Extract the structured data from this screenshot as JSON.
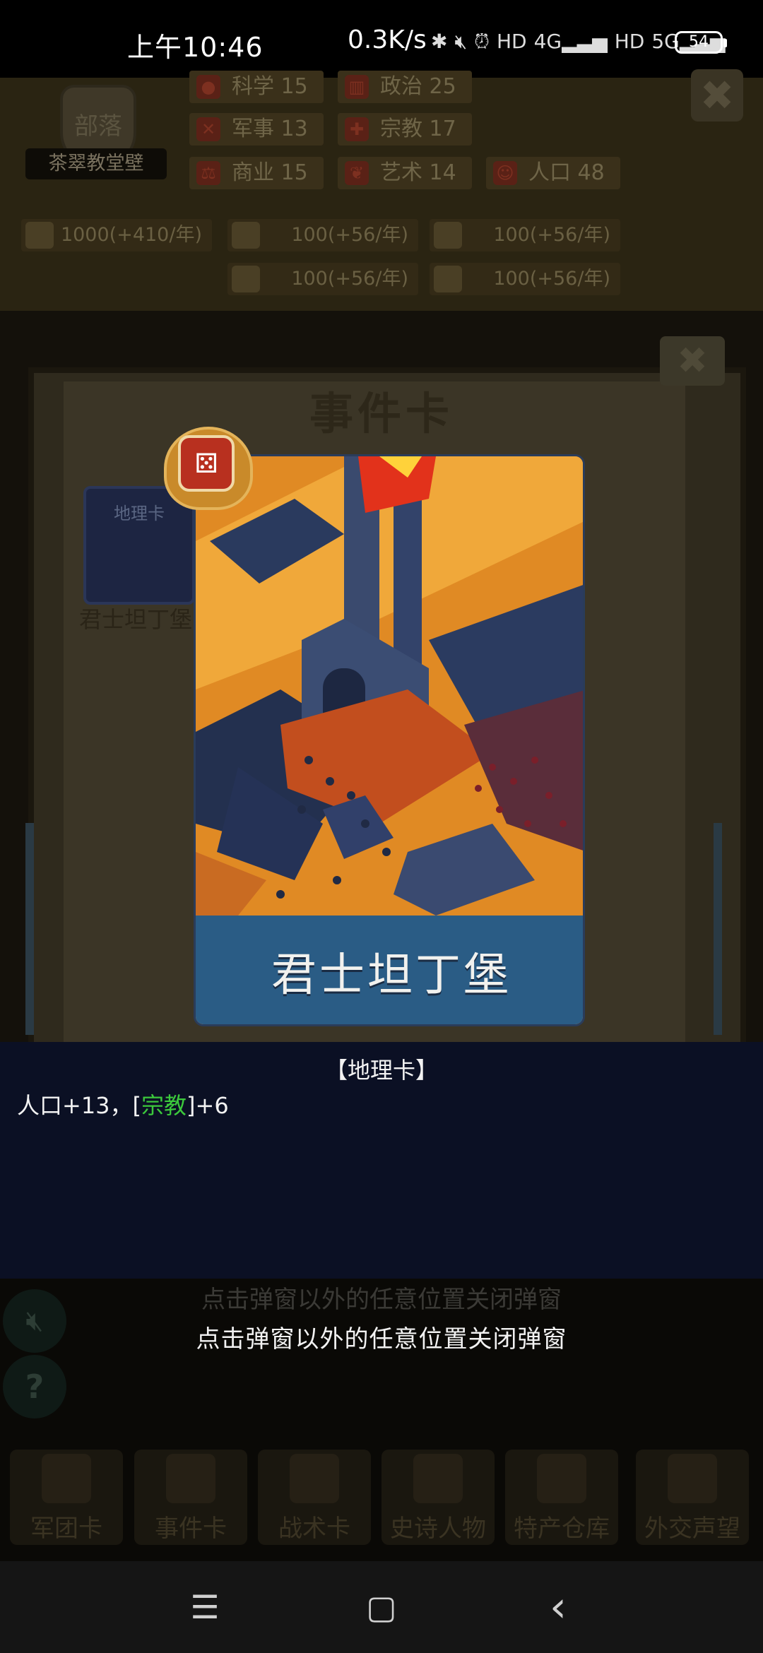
{
  "status_bar": {
    "time": "上午10:46",
    "net_speed": "0.3K/s",
    "icons": [
      "bluetooth-icon",
      "mute-icon",
      "alarm-icon",
      "hd-icon",
      "4g-signal-icon",
      "hd-icon",
      "5g-signal-icon"
    ],
    "battery": "54"
  },
  "game_header": {
    "tribe_badge": "部落",
    "tribe_name": "茶翠教堂壁",
    "stats": [
      {
        "label": "科学 15",
        "icon": "science-icon"
      },
      {
        "label": "政治 25",
        "icon": "politics-icon"
      },
      {
        "label": "军事 13",
        "icon": "military-icon"
      },
      {
        "label": "宗教 17",
        "icon": "religion-icon"
      },
      {
        "label": "商业 15",
        "icon": "commerce-icon"
      },
      {
        "label": "艺术 14",
        "icon": "art-icon"
      },
      {
        "label": "人口 48",
        "icon": "population-icon"
      }
    ],
    "resources": [
      {
        "label": "1000(+410/年)"
      },
      {
        "label": "100(+56/年)"
      },
      {
        "label": "100(+56/年)"
      },
      {
        "label": "100(+56/年)"
      },
      {
        "label": "100(+56/年)"
      }
    ]
  },
  "background_panel": {
    "title": "事件卡",
    "small_card_type": "地理卡",
    "small_card_name": "君士坦丁堡"
  },
  "card": {
    "name": "君士坦丁堡",
    "badge_icon": "map-dice-icon"
  },
  "info": {
    "type": "【地理卡】",
    "effect_prefix": "人口+13，[",
    "effect_highlight": "宗教",
    "effect_suffix": "]+6",
    "highlight_color": "#3cc93c"
  },
  "hints": {
    "dim": "点击弹窗以外的任意位置关闭弹窗",
    "main": "点击弹窗以外的任意位置关闭弹窗"
  },
  "bottom_nav": [
    {
      "label": "军团卡"
    },
    {
      "label": "事件卡"
    },
    {
      "label": "战术卡"
    },
    {
      "label": "史诗人物"
    },
    {
      "label": "特产仓库"
    },
    {
      "label": "外交声望"
    }
  ],
  "system_nav": {
    "menu": "☰",
    "home": "▢",
    "back": "‹"
  }
}
